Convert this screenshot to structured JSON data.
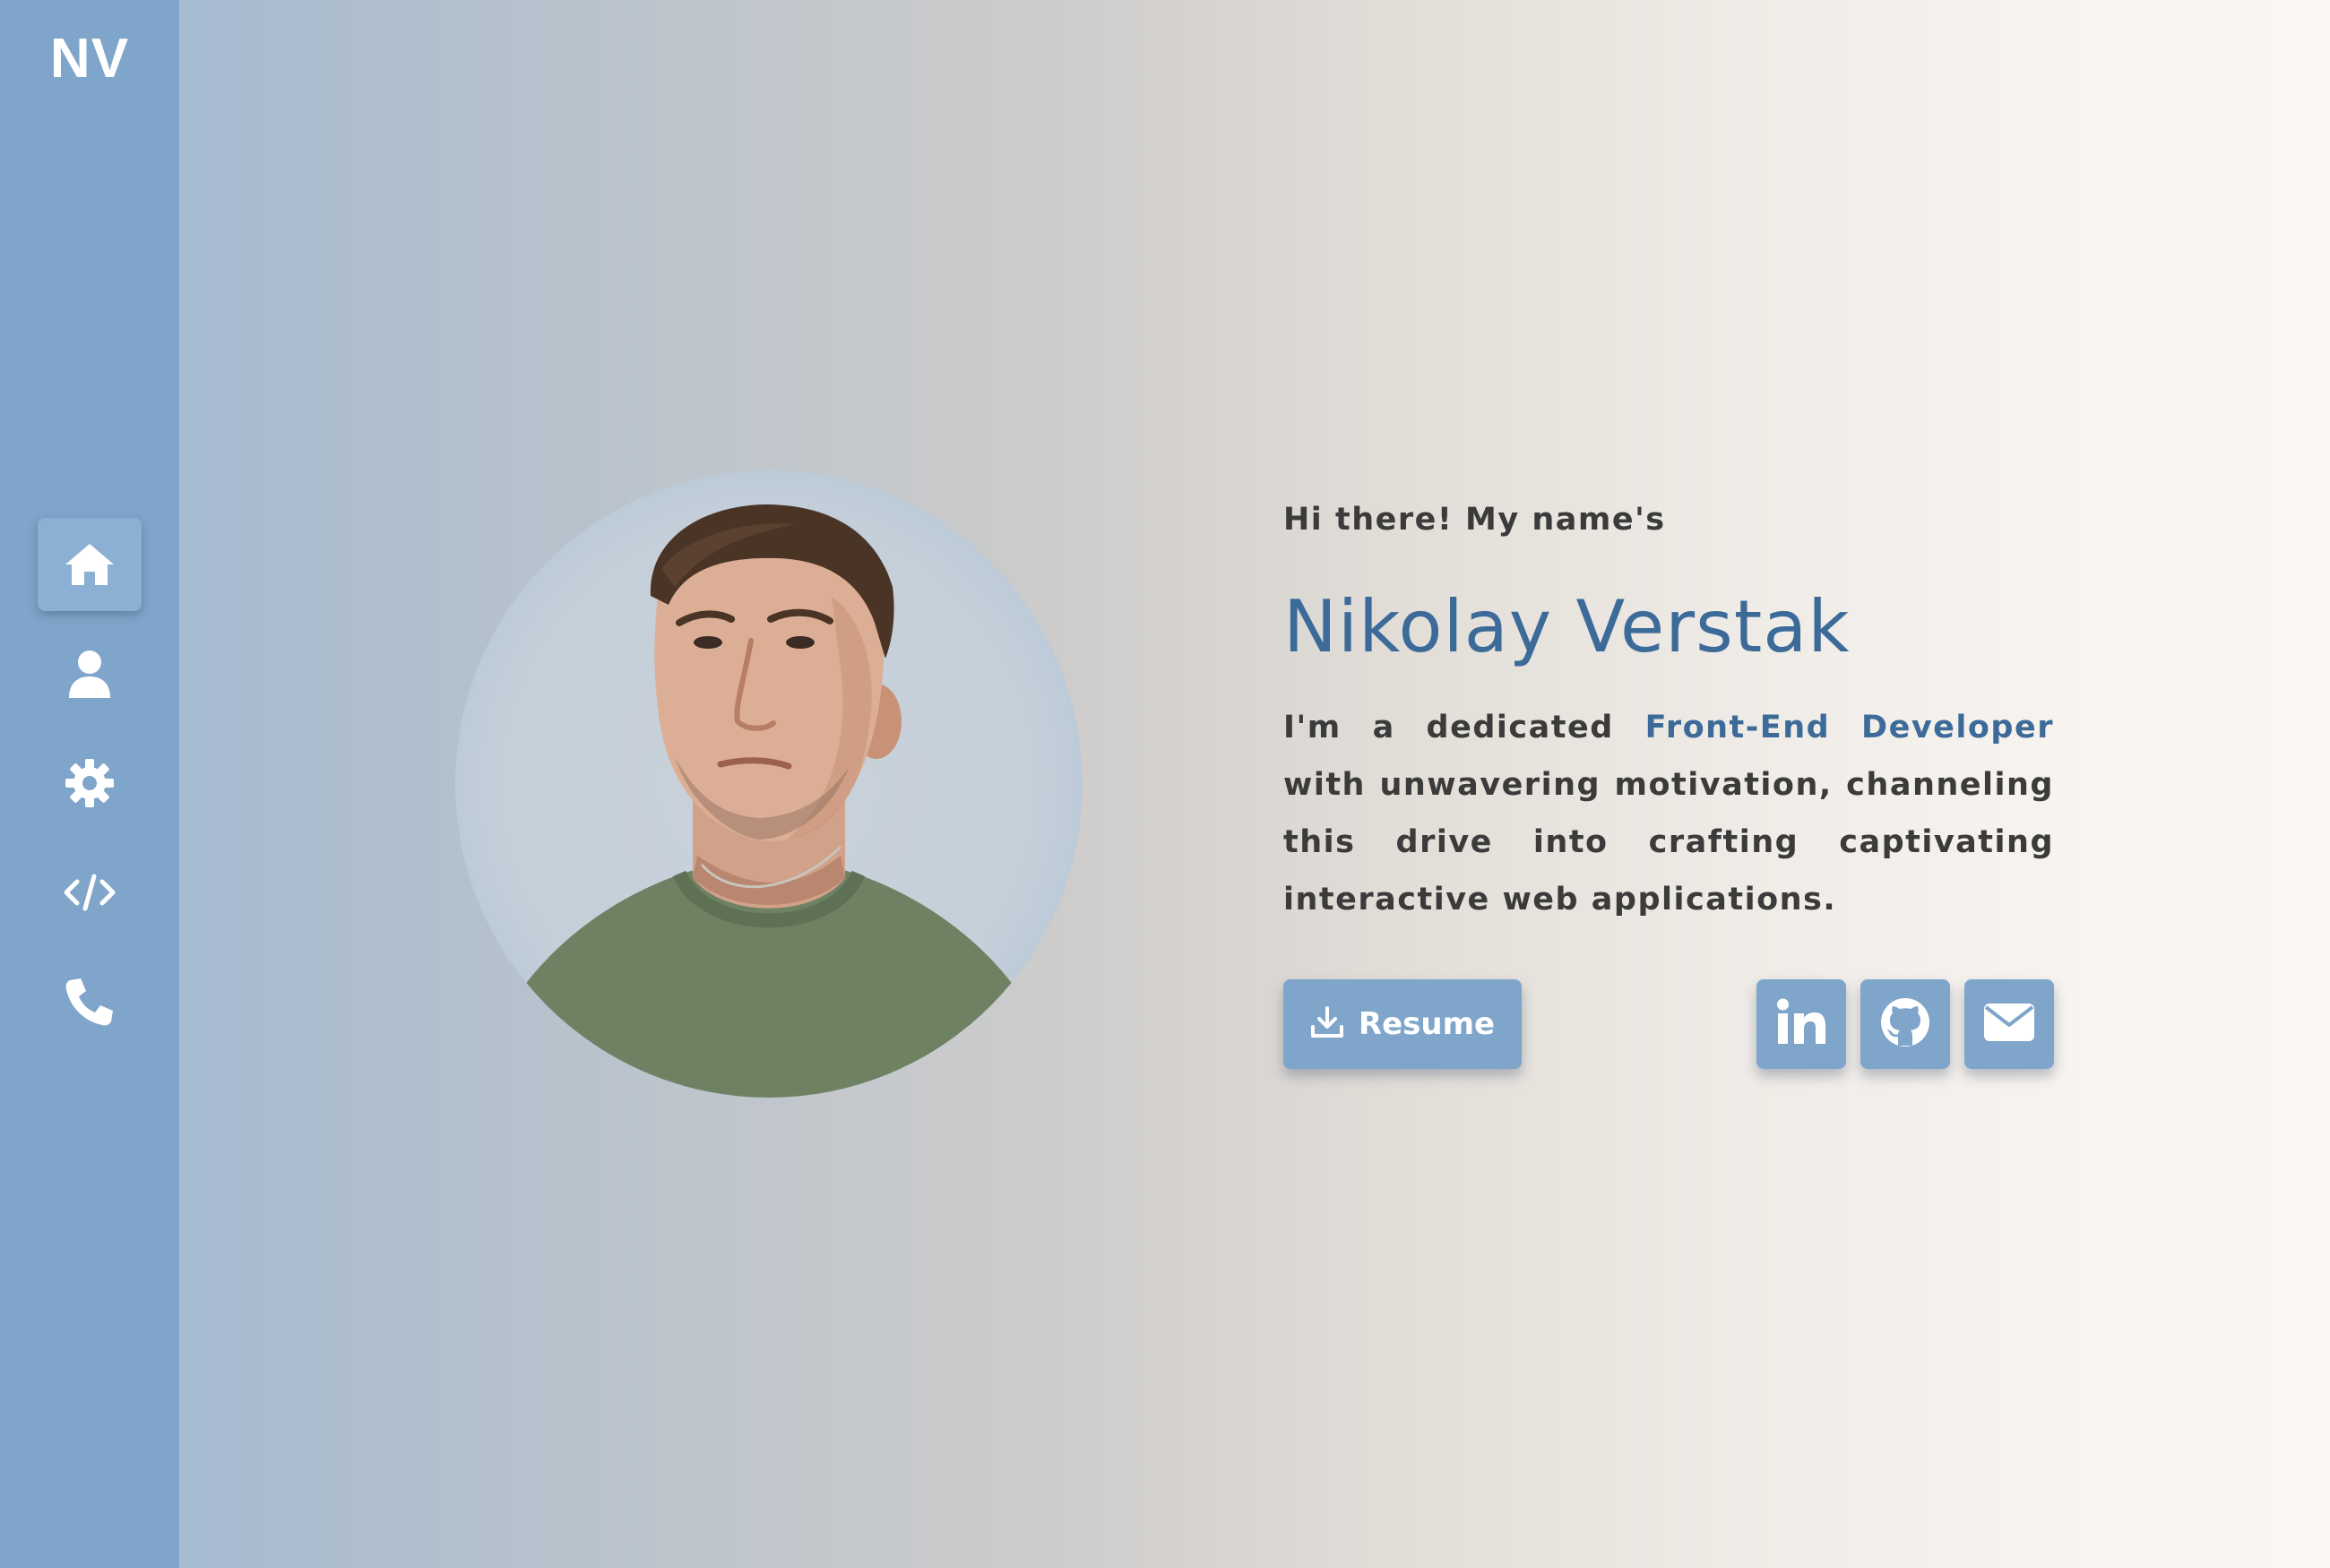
{
  "sidebar": {
    "logo": "NV",
    "items": [
      {
        "icon": "home-icon",
        "active": true
      },
      {
        "icon": "user-icon",
        "active": false
      },
      {
        "icon": "gear-icon",
        "active": false
      },
      {
        "icon": "code-icon",
        "active": false
      },
      {
        "icon": "phone-icon",
        "active": false
      }
    ]
  },
  "hero": {
    "greeting": "Hi there! My name's",
    "name": "Nikolay Verstak",
    "bio_before": "I'm a dedicated ",
    "bio_role": "Front-End Developer",
    "bio_after": " with unwavering motivation, channeling this drive into crafting captivating interactive web applications.",
    "resume_label": "Resume"
  },
  "social": [
    {
      "icon": "linkedin-icon"
    },
    {
      "icon": "github-icon"
    },
    {
      "icon": "email-icon"
    }
  ],
  "colors": {
    "sidebar": "#7fa5ca",
    "accent": "#3d6b99",
    "text": "#3b3b3b",
    "button": "#7fa5ca"
  }
}
